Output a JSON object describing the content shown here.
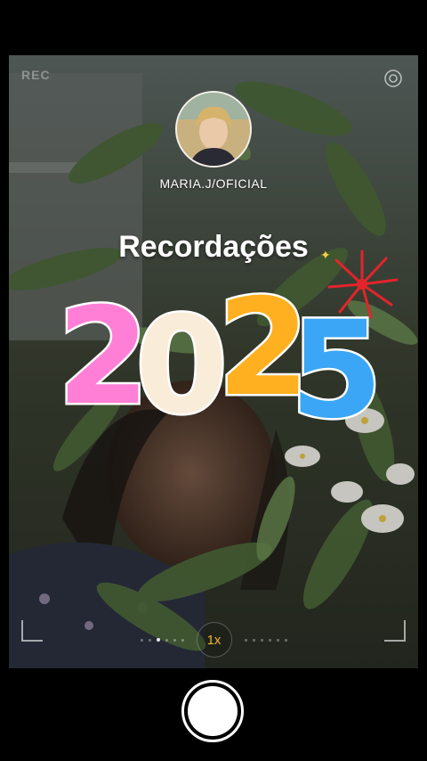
{
  "header": {
    "faint_label": "REC"
  },
  "profile": {
    "username": "MARIA.J/OFICIAL"
  },
  "overlay": {
    "title": "Recordações",
    "year": "2025"
  },
  "camera": {
    "zoom_label": "1x"
  },
  "icons": {
    "settings": "settings-icon",
    "shutter": "shutter-button",
    "sparkle": "sparkle-icon",
    "fireworks": "fireworks-icon"
  },
  "colors": {
    "digit_2_first": "#ff7fd6",
    "digit_0": "#f9ecd9",
    "digit_2_second": "#ffb020",
    "digit_5": "#3aa6f5",
    "zoom_accent": "#f0b429"
  }
}
